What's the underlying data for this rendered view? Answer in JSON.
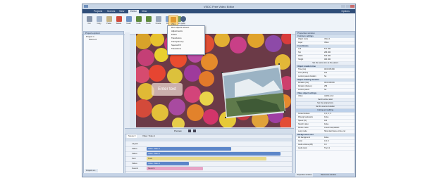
{
  "window": {
    "title": "VSDC Free Video Editor"
  },
  "menubar": {
    "tabs": [
      {
        "label": "Projects"
      },
      {
        "label": "Scenes"
      },
      {
        "label": "View"
      },
      {
        "label": "Editor"
      },
      {
        "label": "View"
      }
    ],
    "right_label": "Options"
  },
  "ribbon": {
    "buttons": [
      {
        "label": "Cut"
      },
      {
        "label": "Copy"
      },
      {
        "label": "Paste"
      },
      {
        "label": "Delete"
      },
      {
        "label": "Insert"
      },
      {
        "label": "Undo"
      },
      {
        "label": "Redo"
      },
      {
        "label": "Create"
      },
      {
        "label": "Run"
      },
      {
        "label": "Add"
      },
      {
        "label": "Video effects"
      },
      {
        "label": "Audio effects"
      }
    ]
  },
  "dropdown": {
    "items": [
      {
        "label": "Run objects wizard..."
      },
      {
        "label": "Adjustments"
      },
      {
        "label": "Filters"
      },
      {
        "label": "Transforms"
      },
      {
        "label": "Transparency"
      },
      {
        "label": "Special FX"
      },
      {
        "label": "Transitions"
      }
    ]
  },
  "project_explorer": {
    "title": "Project explorer",
    "items": [
      {
        "label": "Project 1"
      },
      {
        "label": "Scene 0"
      }
    ],
    "bottom_tab": "Projects ex..."
  },
  "canvas": {
    "textbox_text": "Enter text"
  },
  "properties": {
    "title": "Properties window",
    "sections": {
      "common": "Common settings",
      "coordinates": "Coordinates",
      "creation": "Object creation time",
      "drawing": "Object drawing duration",
      "video_obj": "Video object settings",
      "background": "Background color"
    },
    "rows": {
      "object_name": {
        "k": "Object name",
        "v": "Video 1"
      },
      "layer": {
        "k": "Layer",
        "v": "Video"
      },
      "left": {
        "k": "Left",
        "v": "571.000"
      },
      "top": {
        "k": "Top",
        "v": "286.000"
      },
      "width": {
        "k": "Width",
        "v": "640.000"
      },
      "height": {
        "k": "Height",
        "v": "480.000"
      },
      "time_ms": {
        "k": "Time (ms)",
        "v": "00:00:05.390"
      },
      "time_frame": {
        "k": "Time (frame)",
        "v": "161"
      },
      "lock": {
        "k": "Lock to parent duration",
        "v": "No"
      },
      "duration_ms": {
        "k": "Duration (ms)",
        "v": "00:00:08.650"
      },
      "duration_frames": {
        "k": "Duration (frames)",
        "v": "259"
      },
      "lock2": {
        "k": "Lock to parent",
        "v": "No"
      },
      "video": {
        "k": "Video",
        "v": "wildlife.wmv"
      },
      "cut_borders": {
        "k": "Cutted borders",
        "v": "0; 0; 0; 0"
      },
      "playing": {
        "k": "Playing backwards",
        "v": "False"
      },
      "speed": {
        "k": "Speed (%)",
        "v": "100"
      },
      "stretch": {
        "k": "Stretch video",
        "v": "False"
      },
      "resize": {
        "k": "Resize mode",
        "v": "Linear interpolation"
      },
      "loop": {
        "k": "Loop mode",
        "v": "Show last frame at the end"
      },
      "fill": {
        "k": "Fill background",
        "v": "False"
      },
      "color": {
        "k": "Color",
        "v": "0; 0; 0"
      },
      "volume": {
        "k": "Audio volume (dB)",
        "v": "0.0"
      },
      "track": {
        "k": "Audio track",
        "v": "Track 1"
      }
    },
    "buttons": {
      "same_size": "Set the same size as the parent",
      "show_first": "Set the show start",
      "original": "Set the original size",
      "source_duration": "Set the source duration",
      "cutting": "Cutting and splitting"
    },
    "bottom_tabs": [
      "Properties window",
      "Resources window"
    ]
  },
  "timeline": {
    "tabs": [
      "Scene 0",
      "Video: Video 1"
    ],
    "playback": "Preview",
    "tracks": [
      {
        "name": "Layers"
      },
      {
        "name": "Video",
        "clip": "Video: Video 1"
      },
      {
        "name": "Video",
        "clip": "Video: Video 2"
      },
      {
        "name": "Text",
        "clip": "Text1"
      },
      {
        "name": "Video",
        "clip": "Video: Video 3"
      },
      {
        "name": "Sound",
        "clip": "Sound 1"
      }
    ]
  },
  "colors": {
    "menubar": "#2f4d78",
    "clip_blue": "#5c86c9",
    "clip_text": "#e7d98b",
    "clip_sound": "#e6a4c6",
    "selection": "#fbd98a"
  }
}
